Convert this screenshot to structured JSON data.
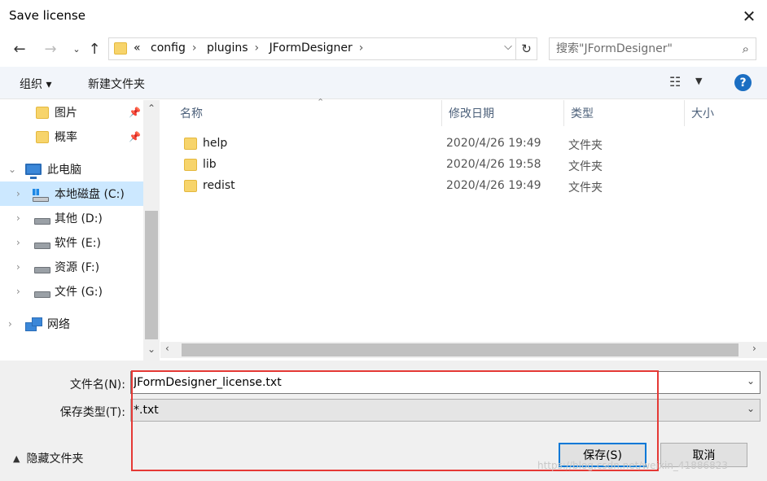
{
  "window": {
    "title": "Save license"
  },
  "nav": {
    "breadcrumb": [
      "«",
      "config",
      "plugins",
      "JFormDesigner"
    ],
    "search_placeholder": "搜索\"JFormDesigner\""
  },
  "toolbar": {
    "organize": "组织 ▾",
    "new_folder": "新建文件夹",
    "help": "?"
  },
  "sidebar": {
    "items": [
      {
        "label": "图片",
        "icon": "folder-icon",
        "pinned": true
      },
      {
        "label": "概率",
        "icon": "folder-icon",
        "pinned": true
      },
      {
        "label": "此电脑",
        "icon": "computer-icon"
      },
      {
        "label": "本地磁盘 (C:)",
        "icon": "drive-icon",
        "selected": true
      },
      {
        "label": "其他 (D:)",
        "icon": "drive-icon"
      },
      {
        "label": "软件 (E:)",
        "icon": "drive-icon"
      },
      {
        "label": "资源 (F:)",
        "icon": "drive-icon"
      },
      {
        "label": "文件 (G:)",
        "icon": "drive-icon"
      },
      {
        "label": "网络",
        "icon": "network-icon"
      }
    ]
  },
  "files": {
    "columns": [
      "名称",
      "修改日期",
      "类型",
      "大小"
    ],
    "rows": [
      {
        "name": "help",
        "date": "2020/4/26 19:49",
        "type": "文件夹"
      },
      {
        "name": "lib",
        "date": "2020/4/26 19:58",
        "type": "文件夹"
      },
      {
        "name": "redist",
        "date": "2020/4/26 19:49",
        "type": "文件夹"
      }
    ]
  },
  "form": {
    "filename_label": "文件名(N):",
    "filename_value": "JFormDesigner_license.txt",
    "type_label": "保存类型(T):",
    "type_value": "*.txt"
  },
  "footer": {
    "hide_folders": "隐藏文件夹",
    "save": "保存(S)",
    "cancel": "取消",
    "watermark": "https://blog.csdn.net/weixin_41886823"
  },
  "colors": {
    "accent": "#0078d7",
    "highlight_box": "#e53935",
    "help": "#1b6ec2"
  }
}
